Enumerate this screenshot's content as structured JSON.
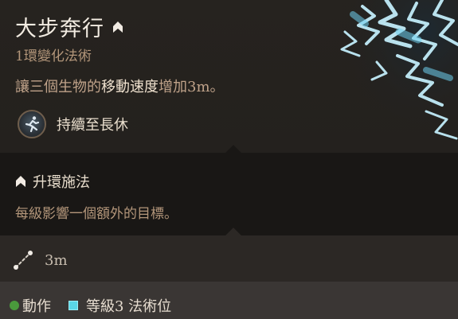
{
  "spell": {
    "name": "大步奔行",
    "school": "1環變化法術",
    "description": {
      "part1": "讓三個生物的",
      "highlight": "移動速度",
      "part2": "增加3m。"
    },
    "duration": "持續至長休"
  },
  "upcast": {
    "title": "升環施法",
    "description": "每級影響一個額外的目標。"
  },
  "range": "3m",
  "cost": {
    "action": "動作",
    "spell_slot": "等級3 法術位"
  },
  "colors": {
    "title": "#f3ece2",
    "subtext": "#b3967a",
    "action_dot": "#4a9a3c",
    "spell_slot": "#5ad6e6"
  },
  "icons": {
    "upcast": "chevron-up-icon",
    "duration": "running-figure-icon",
    "range": "range-icon",
    "action": "action-dot-icon",
    "spell_slot": "spell-slot-icon"
  }
}
